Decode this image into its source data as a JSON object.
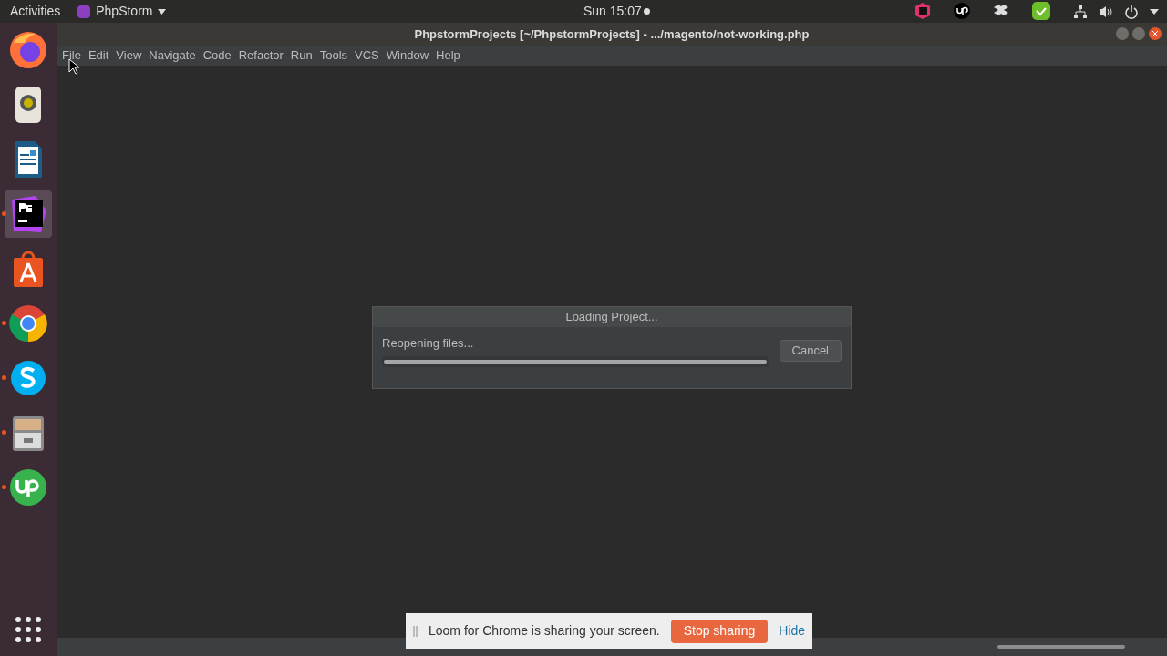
{
  "top_bar": {
    "activities": "Activities",
    "app_menu": "PhpStorm",
    "clock": "Sun 15:07"
  },
  "dock": {
    "items": [
      {
        "kind": "firefox",
        "running": false,
        "selected": false
      },
      {
        "kind": "speaker",
        "running": false,
        "selected": false
      },
      {
        "kind": "writer",
        "running": false,
        "selected": false
      },
      {
        "kind": "phpstorm",
        "running": true,
        "selected": true
      },
      {
        "kind": "store",
        "running": false,
        "selected": false
      },
      {
        "kind": "chrome",
        "running": true,
        "selected": false
      },
      {
        "kind": "skype",
        "running": true,
        "selected": false
      },
      {
        "kind": "files",
        "running": true,
        "selected": false
      },
      {
        "kind": "upwork",
        "running": true,
        "selected": false
      }
    ]
  },
  "window": {
    "title": "PhpstormProjects [~/PhpstormProjects] - .../magento/not-working.php"
  },
  "menu": [
    "File",
    "Edit",
    "View",
    "Navigate",
    "Code",
    "Refactor",
    "Run",
    "Tools",
    "VCS",
    "Window",
    "Help"
  ],
  "dialog": {
    "title": "Loading Project...",
    "message": "Reopening files...",
    "progress": {
      "level": 1
    },
    "button": "Cancel"
  },
  "share_bar": {
    "message": "Loom for Chrome is sharing your screen.",
    "stop": "Stop sharing",
    "hide": "Hide"
  }
}
